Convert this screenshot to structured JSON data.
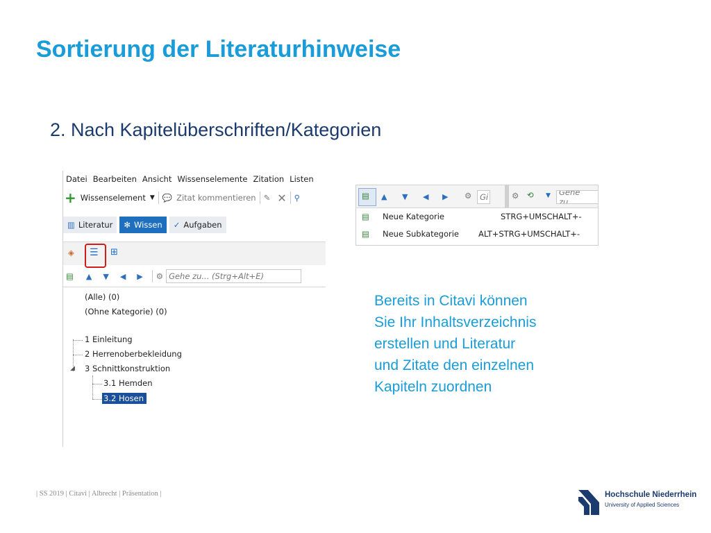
{
  "slide": {
    "title": "Sortierung der Literaturhinweise",
    "subtitle": "2. Nach Kapitelüberschriften/Kategorien",
    "description": "Bereits in Citavi können Sie Ihr Inhaltsverzeichnis erstellen und Literatur und Zitate den einzelnen Kapiteln zuordnen",
    "footer": "| SS 2019 | Citavi | Albrecht | Präsentation |",
    "logo_name": "Hochschule Niederrhein",
    "logo_tagline": "University of Applied Sciences"
  },
  "citavi_main": {
    "menu": [
      "Datei",
      "Bearbeiten",
      "Ansicht",
      "Wissenselemente",
      "Zitation",
      "Listen"
    ],
    "toolbar": {
      "new_knowledge": "Wissenselement",
      "comment_quote": "Zitat kommentieren"
    },
    "nav_tabs": [
      {
        "label": "Literatur",
        "active": false
      },
      {
        "label": "Wissen",
        "active": true
      },
      {
        "label": "Aufgaben",
        "active": false
      }
    ],
    "search_placeholder": "Gehe zu... (Strg+Alt+E)",
    "tree": {
      "all": "(Alle) (0)",
      "uncategorized": "(Ohne Kategorie) (0)",
      "items": [
        {
          "label": "1 Einleitung"
        },
        {
          "label": "2 Herrenoberbekleidung"
        },
        {
          "label": "3 Schnittkonstruktion",
          "expanded": true
        },
        {
          "label": "3.1 Hemden"
        },
        {
          "label": "3.2 Hosen",
          "selected": true
        }
      ]
    }
  },
  "citavi_menu": {
    "search_placeholder_short": "Gi",
    "search_placeholder": "Gehe zu...",
    "items": [
      {
        "label": "Neue Kategorie",
        "shortcut": "STRG+UMSCHALT+-"
      },
      {
        "label": "Neue Subkategorie",
        "shortcut": "ALT+STRG+UMSCHALT+-"
      }
    ]
  },
  "colors": {
    "accent_blue": "#1a9cd8",
    "dark_blue": "#1b3a6e",
    "selection": "#1a4f9c",
    "highlight_red": "#d11c1c"
  }
}
